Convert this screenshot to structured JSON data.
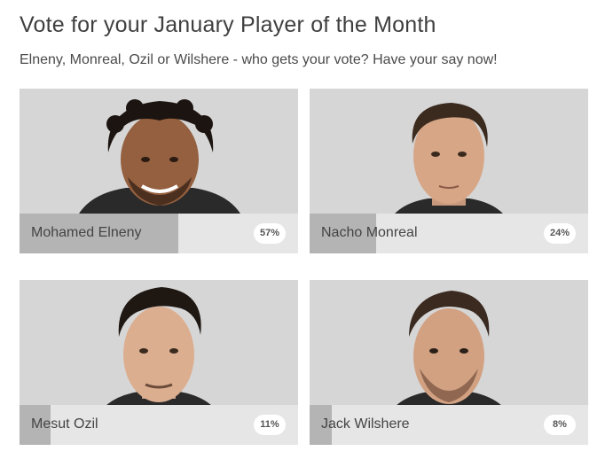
{
  "poll": {
    "title": "Vote for your January Player of the Month",
    "subtitle": "Elneny, Monreal, Ozil or Wilshere - who gets your vote? Have your say now!",
    "players": [
      {
        "name": "Mohamed Elneny",
        "percent_label": "57%",
        "percent": 57
      },
      {
        "name": "Nacho Monreal",
        "percent_label": "24%",
        "percent": 24
      },
      {
        "name": "Mesut Ozil",
        "percent_label": "11%",
        "percent": 11
      },
      {
        "name": "Jack Wilshere",
        "percent_label": "8%",
        "percent": 8
      }
    ]
  },
  "colors": {
    "photo_background": "#d3d3d3",
    "bar_track": "#e6e6e6",
    "bar_fill": "#b4b4b4",
    "badge_background": "#ffffff",
    "text": "#444444"
  }
}
